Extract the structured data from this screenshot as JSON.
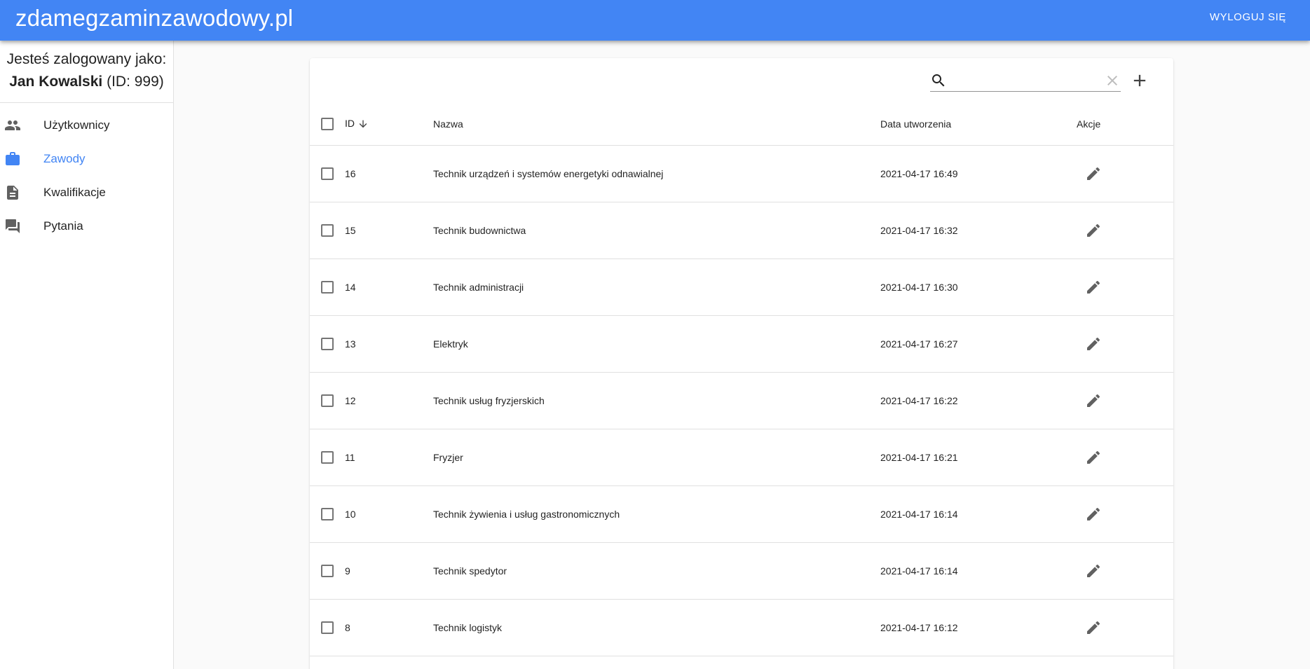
{
  "app": {
    "title": "zdamegzaminzawodowy.pl",
    "logout_label": "WYLOGUJ SIĘ"
  },
  "user": {
    "logged_as": "Jesteś zalogowany jako:",
    "name": "Jan Kowalski",
    "id_text": "(ID: 999)"
  },
  "sidebar": {
    "items": [
      {
        "label": "Użytkownicy",
        "icon": "people-icon",
        "active": false
      },
      {
        "label": "Zawody",
        "icon": "briefcase-icon",
        "active": true
      },
      {
        "label": "Kwalifikacje",
        "icon": "document-icon",
        "active": false
      },
      {
        "label": "Pytania",
        "icon": "forum-icon",
        "active": false
      }
    ]
  },
  "search": {
    "value": "",
    "placeholder": ""
  },
  "table": {
    "headers": {
      "id": "ID",
      "name": "Nazwa",
      "date": "Data utworzenia",
      "actions": "Akcje"
    },
    "sort": {
      "column": "ID",
      "direction": "desc"
    },
    "rows": [
      {
        "id": "16",
        "name": "Technik urządzeń i systemów energetyki odnawialnej",
        "date": "2021-04-17 16:49"
      },
      {
        "id": "15",
        "name": "Technik budownictwa",
        "date": "2021-04-17 16:32"
      },
      {
        "id": "14",
        "name": "Technik administracji",
        "date": "2021-04-17 16:30"
      },
      {
        "id": "13",
        "name": "Elektryk",
        "date": "2021-04-17 16:27"
      },
      {
        "id": "12",
        "name": "Technik usług fryzjerskich",
        "date": "2021-04-17 16:22"
      },
      {
        "id": "11",
        "name": "Fryzjer",
        "date": "2021-04-17 16:21"
      },
      {
        "id": "10",
        "name": "Technik żywienia i usług gastronomicznych",
        "date": "2021-04-17 16:14"
      },
      {
        "id": "9",
        "name": "Technik spedytor",
        "date": "2021-04-17 16:14"
      },
      {
        "id": "8",
        "name": "Technik logistyk",
        "date": "2021-04-17 16:12"
      }
    ]
  },
  "colors": {
    "primary": "#4285f4",
    "icon_gray": "#616161"
  }
}
